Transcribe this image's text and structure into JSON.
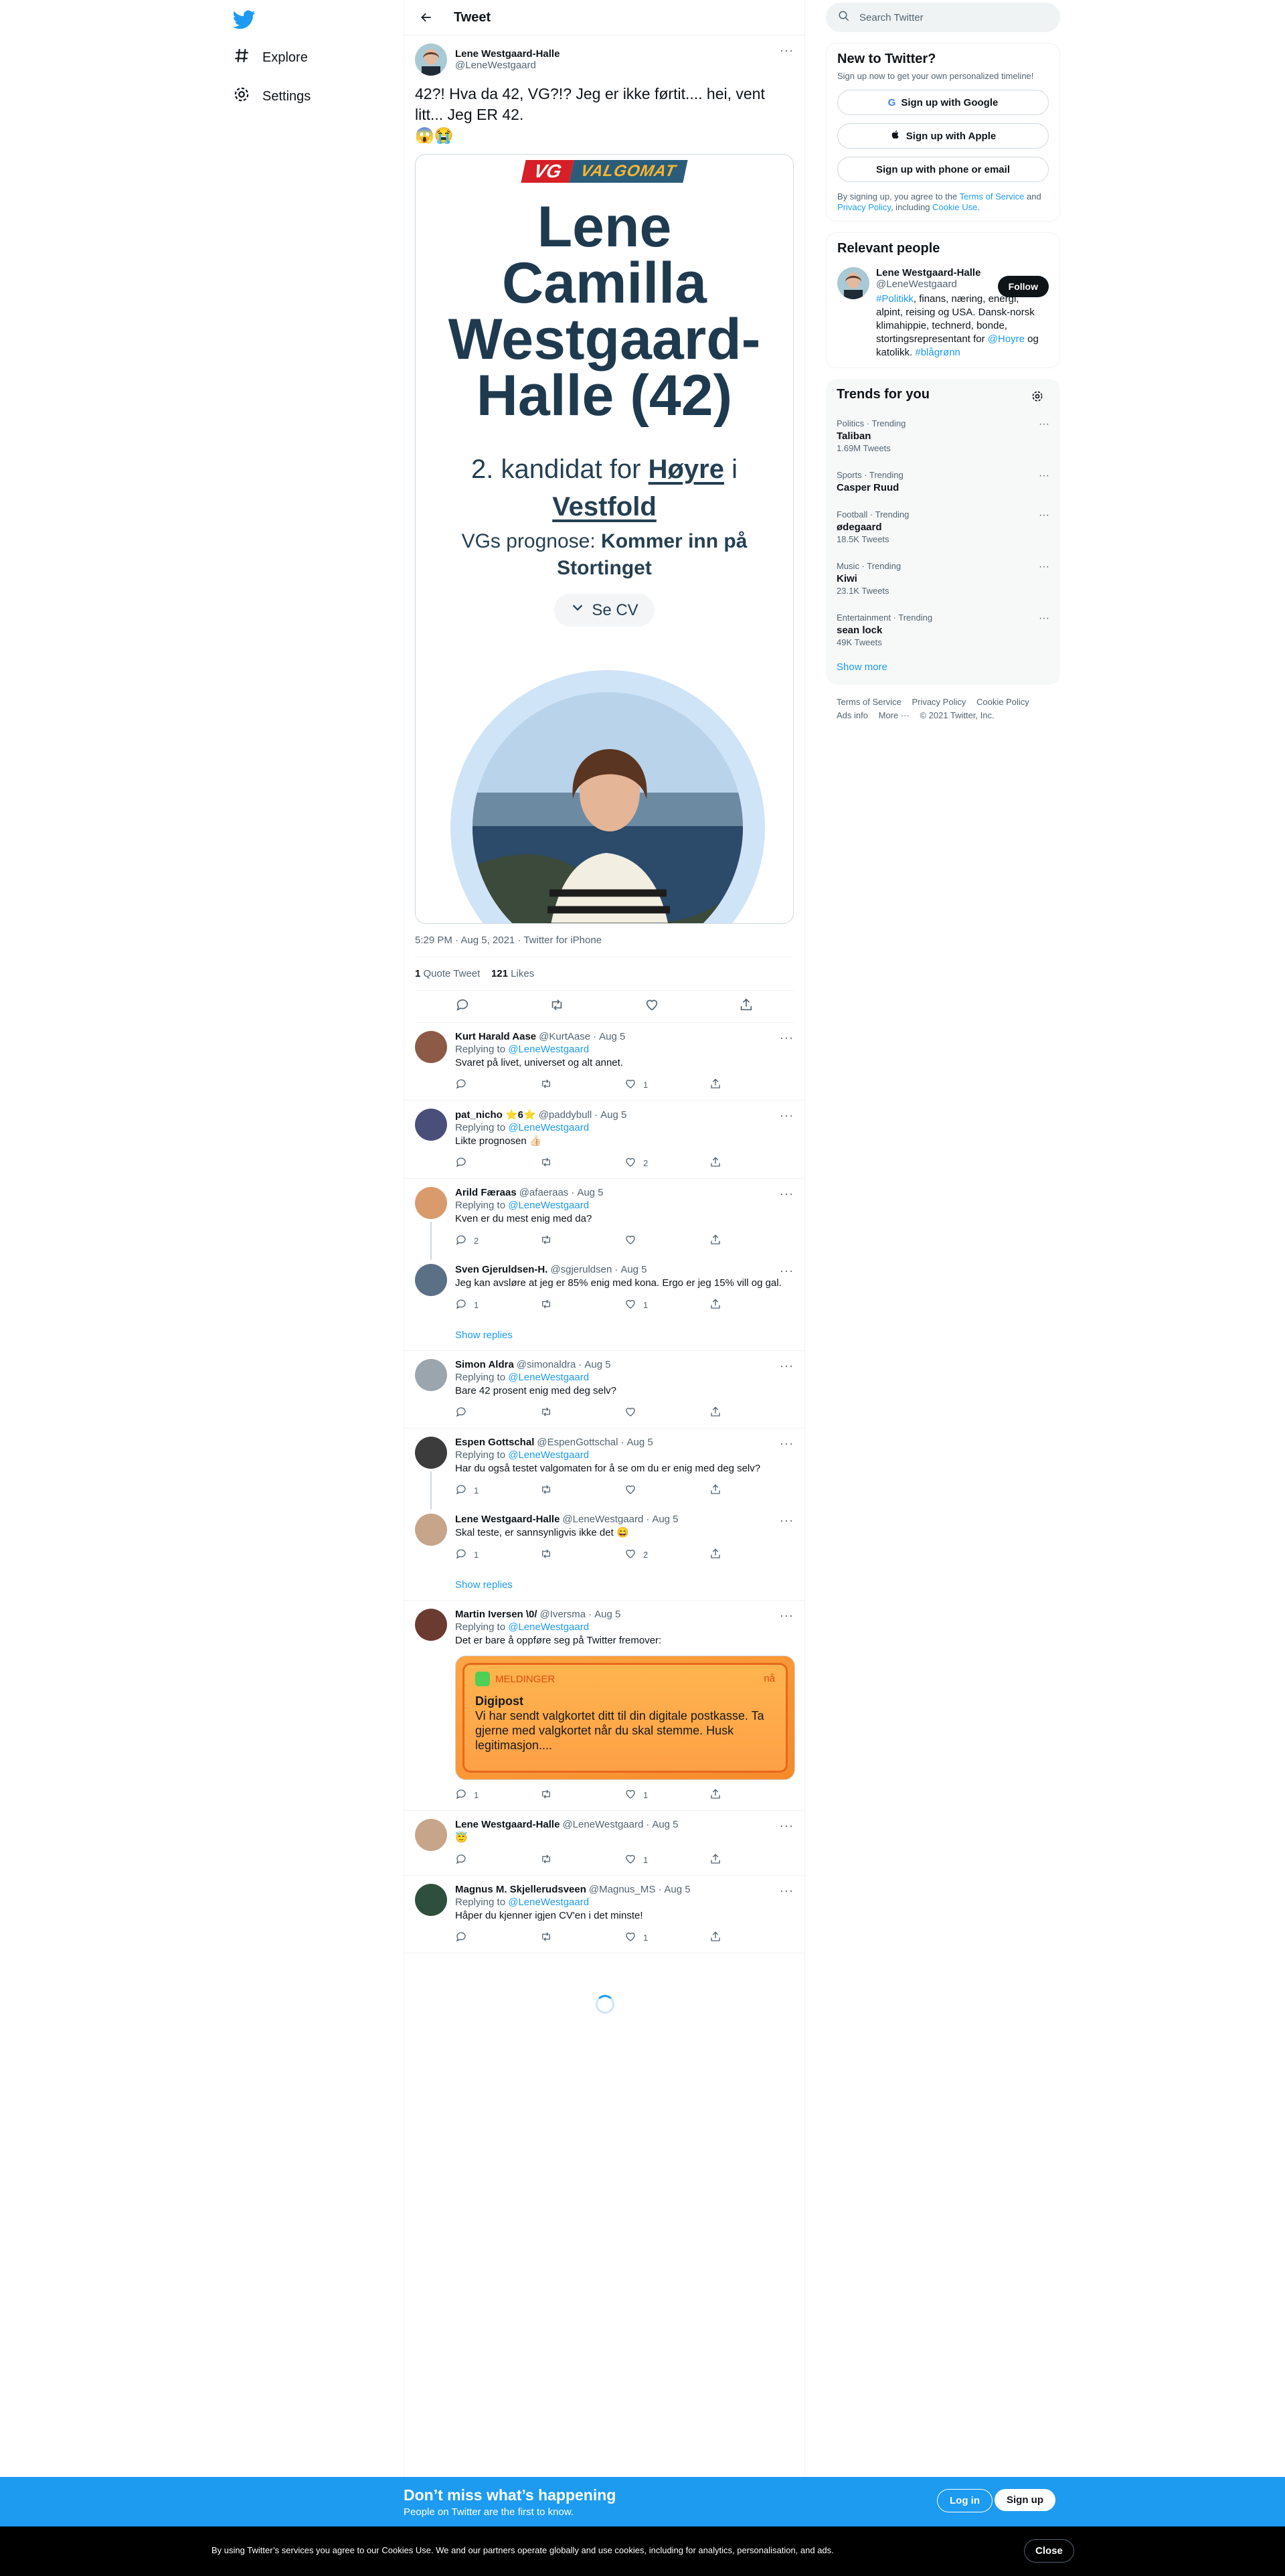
{
  "nav": {
    "explore": "Explore",
    "settings": "Settings"
  },
  "header": {
    "title": "Tweet"
  },
  "tweet": {
    "name": "Lene Westgaard-Halle",
    "handle": "@LeneWestgaard",
    "text": "42?! Hva da 42, VG?!? Jeg er ikke førtit.... hei, vent litt... Jeg ER 42.",
    "emoji": "😱😭",
    "timestamp": "5:29 PM · Aug 5, 2021 · Twitter for iPhone",
    "quote_count": "1",
    "quote_label": "Quote Tweet",
    "like_count": "121",
    "like_label": "Likes"
  },
  "embed": {
    "logo_left": "VG",
    "logo_right": "VALGOMAT",
    "name_lines": [
      "Lene",
      "Camilla",
      "Westgaard-",
      "Halle (42)"
    ],
    "role_prefix": "2. kandidat for ",
    "party": "Høyre",
    "role_mid": " i",
    "county": "Vestfold",
    "prognosis_label": "VGs prognose: ",
    "prognosis_value": "Kommer inn på Stortinget",
    "cv_button": "Se CV"
  },
  "replies": [
    {
      "name": "Kurt Harald Aase",
      "handle": "@KurtAase",
      "date": "Aug 5",
      "replying": "Replying to",
      "to": "@LeneWestgaard",
      "text": "Svaret på livet, universet og alt annet.",
      "reply_count": "",
      "like_count": "1",
      "color": "#8d5a48"
    },
    {
      "name": "pat_nicho ⭐6⭐",
      "handle": "@paddybull",
      "date": "Aug 5",
      "replying": "Replying to",
      "to": "@LeneWestgaard",
      "text": "Likte prognosen 👍🏻",
      "reply_count": "",
      "like_count": "2",
      "color": "#4a4f7a"
    },
    {
      "name": "Arild Færaas",
      "handle": "@afaeraas",
      "date": "Aug 5",
      "replying": "Replying to",
      "to": "@LeneWestgaard",
      "text": "Kven er du mest enig med da?",
      "reply_count": "2",
      "like_count": "",
      "color": "#d99a6c"
    },
    {
      "name": "Sven Gjeruldsen-H.",
      "handle": "@sgjeruldsen",
      "date": "Aug 5",
      "replying": "",
      "to": "",
      "text": "Jeg kan avsløre at jeg er 85% enig med kona. Ergo er jeg 15% vill og gal.",
      "reply_count": "1",
      "like_count": "1",
      "color": "#5b6f85"
    },
    {
      "name": "Simon Aldra",
      "handle": "@simonaldra",
      "date": "Aug 5",
      "replying": "Replying to",
      "to": "@LeneWestgaard",
      "text": "Bare 42 prosent enig med deg selv?",
      "reply_count": "",
      "like_count": "",
      "color": "#9aa5ad"
    },
    {
      "name": "Espen Gottschal",
      "handle": "@EspenGottschal",
      "date": "Aug 5",
      "replying": "Replying to",
      "to": "@LeneWestgaard",
      "text": "Har du også testet valgomaten for å se om du er enig med deg selv?",
      "reply_count": "1",
      "like_count": "",
      "color": "#3c3c3c"
    },
    {
      "name": "Lene Westgaard-Halle",
      "handle": "@LeneWestgaard",
      "date": "Aug 5",
      "replying": "",
      "to": "",
      "text": "Skal teste, er sannsynligvis ikke det 😄",
      "reply_count": "1",
      "like_count": "2",
      "color": "#c7a58a"
    },
    {
      "name": "Martin Iversen \\0/",
      "handle": "@Iversma",
      "date": "Aug 5",
      "replying": "Replying to",
      "to": "@LeneWestgaard",
      "text": "Det er bare å oppføre seg på Twitter fremover:",
      "reply_count": "1",
      "like_count": "1",
      "color": "#6b3b32"
    },
    {
      "name": "Lene Westgaard-Halle",
      "handle": "@LeneWestgaard",
      "date": "Aug 5",
      "replying": "",
      "to": "",
      "text": "😇",
      "reply_count": "",
      "like_count": "1",
      "color": "#c7a58a"
    },
    {
      "name": "Magnus M. Skjellerudsveen",
      "handle": "@Magnus_MS",
      "date": "Aug 5",
      "replying": "Replying to",
      "to": "@LeneWestgaard",
      "text": "Håper du kjenner igjen CV'en i det minste!",
      "reply_count": "",
      "like_count": "1",
      "color": "#2f4f3e"
    }
  ],
  "show_replies": "Show replies",
  "notif": {
    "app": "MELDINGER",
    "time": "nå",
    "title": "Digipost",
    "body": "Vi har sendt valgkortet ditt til din digitale postkasse. Ta gjerne med valgkortet når du skal stemme. Husk legitimasjon...."
  },
  "search": {
    "placeholder": "Search Twitter"
  },
  "new_to_twitter": {
    "title": "New to Twitter?",
    "subtitle": "Sign up now to get your own personalized timeline!",
    "google": "Sign up with Google",
    "apple": "Sign up with Apple",
    "phone": "Sign up with phone or email",
    "terms_prefix": "By signing up, you agree to the ",
    "terms": "Terms of Service",
    "and": " and ",
    "privacy": "Privacy Policy",
    "including": ", including ",
    "cookie": "Cookie Use",
    "period": "."
  },
  "relevant": {
    "title": "Relevant people",
    "name": "Lene Westgaard-Halle",
    "handle": "@LeneWestgaard",
    "follow": "Follow",
    "bio_tag": "#Politikk",
    "bio_1": ", finans, næring, energi, alpint, reising og USA. Dansk-norsk klimahippie, technerd, bonde, stortingsrepresentant for ",
    "bio_mention": "@Hoyre",
    "bio_2": " og katolikk. ",
    "bio_tag2": "#blågrønn"
  },
  "trends": {
    "title": "Trends for you",
    "items": [
      {
        "context": "Politics · Trending",
        "name": "Taliban",
        "count": "1.69M Tweets"
      },
      {
        "context": "Sports · Trending",
        "name": "Casper Ruud",
        "count": ""
      },
      {
        "context": "Football · Trending",
        "name": "ødegaard",
        "count": "18.5K Tweets"
      },
      {
        "context": "Music · Trending",
        "name": "Kiwi",
        "count": "23.1K Tweets"
      },
      {
        "context": "Entertainment · Trending",
        "name": "sean lock",
        "count": "49K Tweets"
      }
    ],
    "show_more": "Show more"
  },
  "footer": {
    "tos": "Terms of Service",
    "privacy": "Privacy Policy",
    "cookie": "Cookie Policy",
    "ads": "Ads info",
    "more": "More ···",
    "copy": "© 2021 Twitter, Inc."
  },
  "bottom_bar": {
    "title": "Don’t miss what’s happening",
    "subtitle": "People on Twitter are the first to know.",
    "login": "Log in",
    "signup": "Sign up"
  },
  "cookie_bar": {
    "text": "By using Twitter’s services you agree to our Cookies Use. We and our partners operate globally and use cookies, including for analytics, personalisation, and ads.",
    "close": "Close"
  },
  "colors": {
    "accent": "#1d9bf0",
    "vg_red": "#d61f26",
    "vg_blue": "#2b5d7a",
    "text_dark": "#253f52"
  }
}
